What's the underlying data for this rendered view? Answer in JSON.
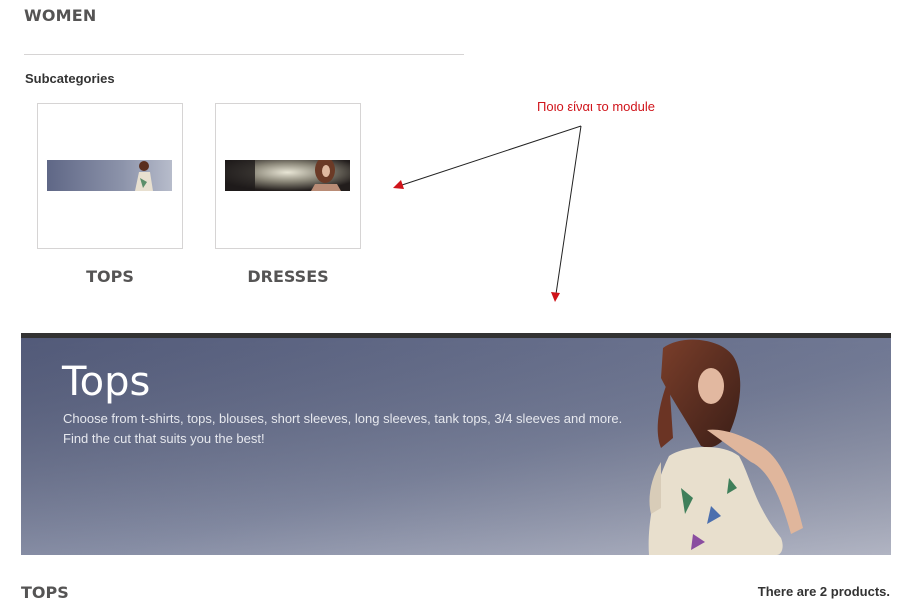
{
  "category": {
    "title": "WOMEN"
  },
  "subcategories": {
    "heading": "Subcategories",
    "items": [
      {
        "name": "TOPS"
      },
      {
        "name": "DRESSES"
      }
    ]
  },
  "annotation": {
    "text": "Ποιο είναι το module",
    "color": "#d0141b"
  },
  "banner": {
    "title": "Tops",
    "description_lines": [
      "Choose from t-shirts, tops, blouses, short sleeves, long sleeves, tank tops, 3/4 sleeves and more.",
      "Find the cut that suits you the best!"
    ],
    "border_color": "#333333"
  },
  "products": {
    "heading": "TOPS",
    "count_text": "There are 2 products."
  }
}
